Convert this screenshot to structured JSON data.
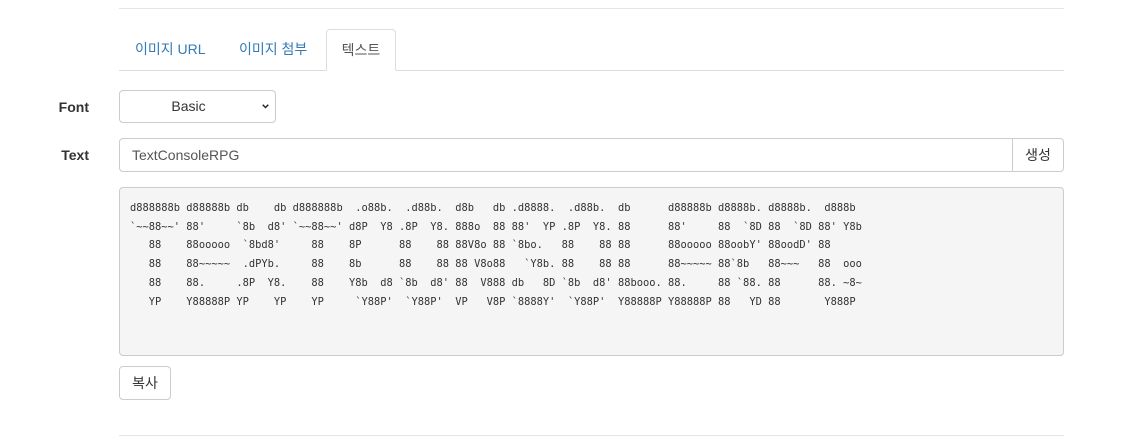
{
  "tabs": [
    {
      "label": "이미지 URL",
      "active": false
    },
    {
      "label": "이미지 첨부",
      "active": false
    },
    {
      "label": "텍스트",
      "active": true
    }
  ],
  "form": {
    "font_label": "Font",
    "font_value": "Basic",
    "text_label": "Text",
    "text_value": "TextConsoleRPG",
    "generate_label": "생성"
  },
  "output": {
    "ascii": "d888888b d88888b db    db d888888b  .o88b.  .d88b.  d8b   db .d8888.  .d88b.  db      d88888b d8888b. d8888b.  d888b \n`~~88~~' 88'     `8b  d8' `~~88~~' d8P  Y8 .8P  Y8. 888o  88 88'  YP .8P  Y8. 88      88'     88  `8D 88  `8D 88' Y8b\n   88    88ooooo  `8bd8'     88    8P      88    88 88V8o 88 `8bo.   88    88 88      88ooooo 88oobY' 88oodD' 88     \n   88    88~~~~~  .dPYb.     88    8b      88    88 88 V8o88   `Y8b. 88    88 88      88~~~~~ 88`8b   88~~~   88  ooo\n   88    88.     .8P  Y8.    88    Y8b  d8 `8b  d8' 88  V888 db   8D `8b  d8' 88booo. 88.     88 `88. 88      88. ~8~\n   YP    Y88888P YP    YP    YP     `Y88P'  `Y88P'  VP   V8P `8888Y'  `Y88P'  Y88888P Y88888P 88   YD 88       Y888P "
  },
  "copy_label": "복사"
}
